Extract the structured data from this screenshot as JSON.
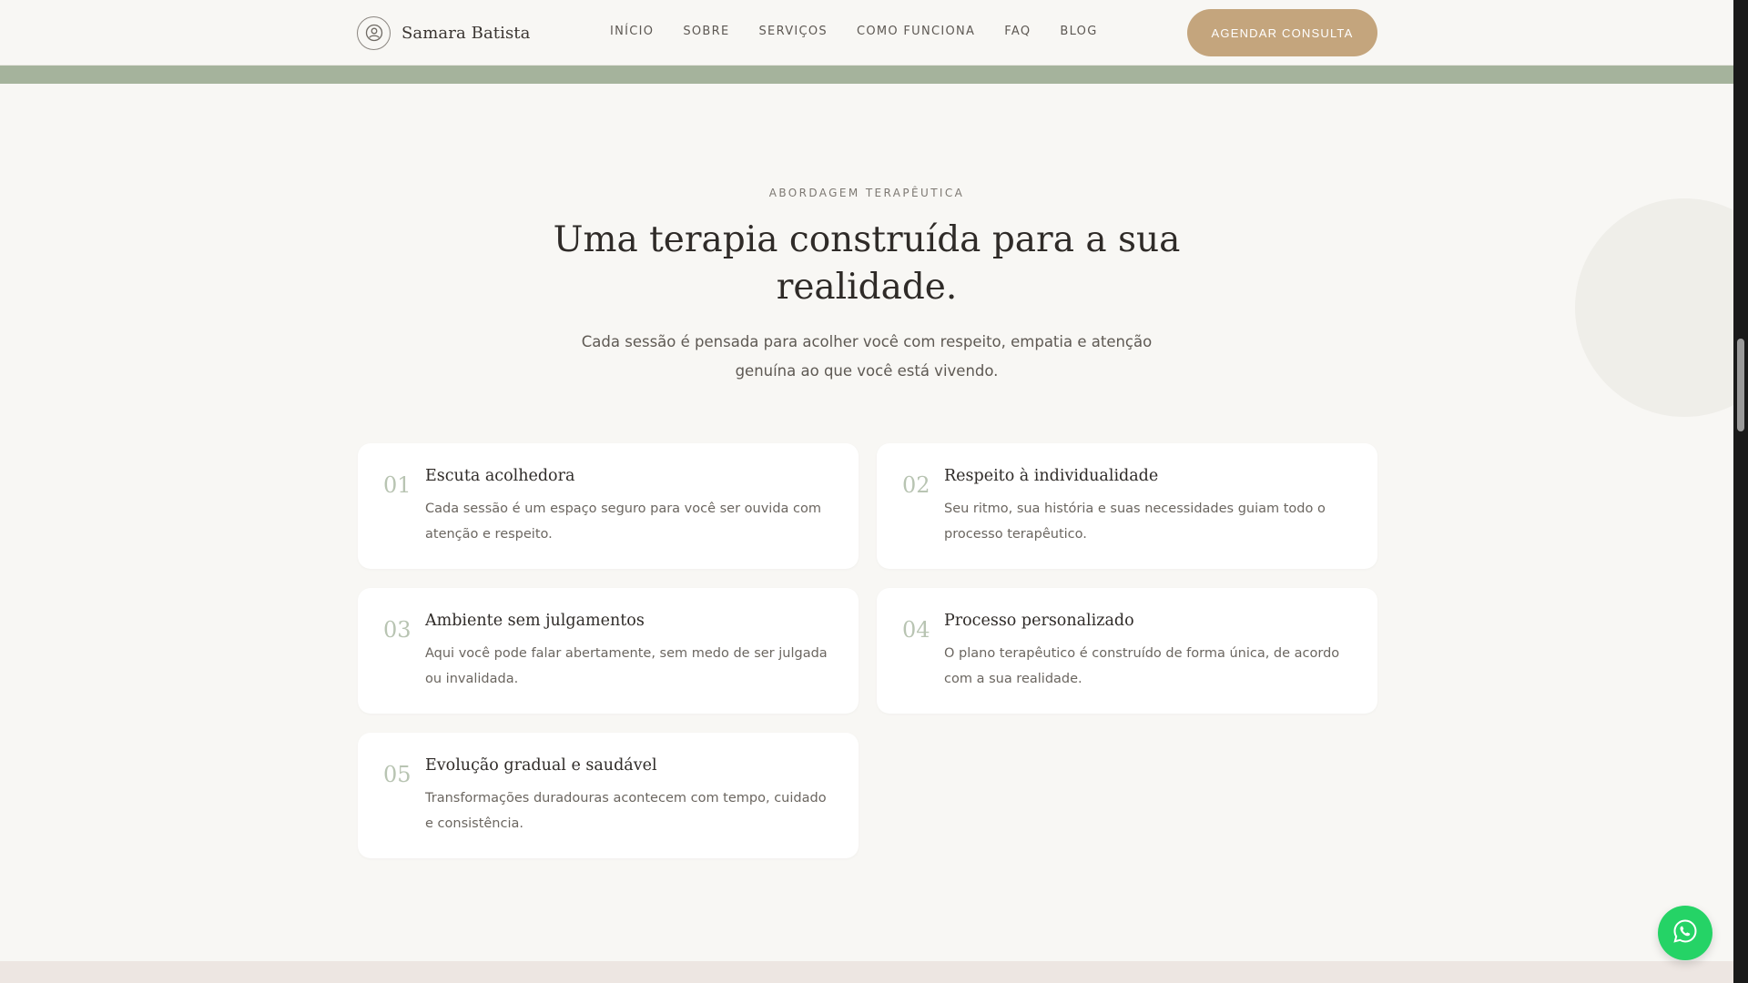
{
  "header": {
    "brand_name": "Samara Batista",
    "brand_icon": "user-circle-icon",
    "nav": [
      {
        "label": "INÍCIO"
      },
      {
        "label": "SOBRE"
      },
      {
        "label": "SERVIÇOS"
      },
      {
        "label": "COMO FUNCIONA"
      },
      {
        "label": "FAQ"
      },
      {
        "label": "BLOG"
      }
    ],
    "cta_label": "AGENDAR CONSULTA"
  },
  "section": {
    "eyebrow": "ABORDAGEM TERAPÊUTICA",
    "title": "Uma terapia construída para a sua realidade.",
    "subtitle": "Cada sessão é pensada para acolher você com respeito, empatia e atenção genuína ao que você está vivendo."
  },
  "cards": [
    {
      "number": "01",
      "title": "Escuta acolhedora",
      "text": "Cada sessão é um espaço seguro para você ser ouvida com atenção e respeito."
    },
    {
      "number": "02",
      "title": "Respeito à individualidade",
      "text": "Seu ritmo, sua história e suas necessidades guiam todo o processo terapêutico."
    },
    {
      "number": "03",
      "title": "Ambiente sem julgamentos",
      "text": "Aqui você pode falar abertamente, sem medo de ser julgada ou invalidada."
    },
    {
      "number": "04",
      "title": "Processo personalizado",
      "text": "O plano terapêutico é construído de forma única, de acordo com a sua realidade."
    },
    {
      "number": "05",
      "title": "Evolução gradual e saudável",
      "text": "Transformações duradouras acontecem com tempo, cuidado e consistência."
    }
  ],
  "floating": {
    "whatsapp_icon": "whatsapp-icon"
  },
  "colors": {
    "background": "#f8f7f4",
    "accent": "#c4a57d",
    "sage": "#a5b39c",
    "whatsapp": "#25d366"
  }
}
